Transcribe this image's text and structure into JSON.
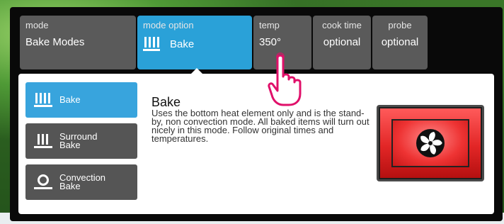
{
  "tabs": {
    "mode": {
      "label": "mode",
      "value": "Bake Modes"
    },
    "mode_option": {
      "label": "mode option",
      "value": "Bake",
      "icon": "bake-element-icon"
    },
    "temp": {
      "label": "temp",
      "value": "350°"
    },
    "cook_time": {
      "label": "cook time",
      "value": "optional"
    },
    "probe": {
      "label": "probe",
      "value": "optional"
    }
  },
  "mode_buttons": [
    {
      "label": "Bake",
      "icon": "bake-element-icon",
      "selected": true
    },
    {
      "label": "Surround Bake",
      "icon": "surround-bake-icon",
      "selected": false
    },
    {
      "label": "Convection Bake",
      "icon": "convection-bake-icon",
      "selected": false
    }
  ],
  "description": {
    "title": "Bake",
    "text": "Uses the bottom heat element only and is the stand-by, non convection mode. All baked items will turn out nicely in this mode. Follow original times and temperatures."
  },
  "illustration": {
    "name": "oven-fan-icon",
    "colors": {
      "accent": "#2aa1d8",
      "oven_red": "#e22626",
      "pointer_hand": "#e0106a"
    }
  }
}
